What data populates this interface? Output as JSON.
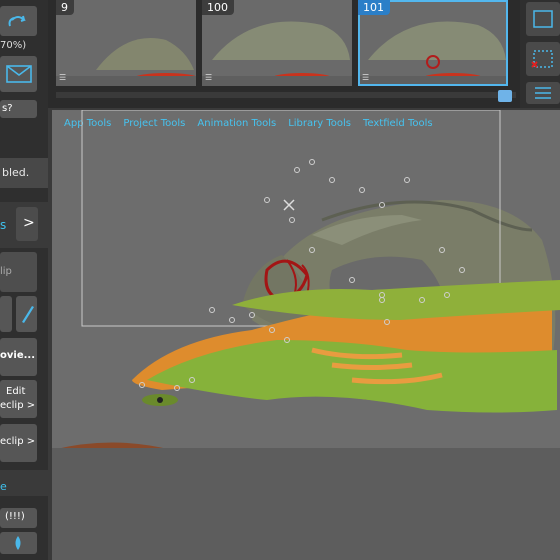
{
  "timeline": {
    "frames": [
      {
        "number": "9"
      },
      {
        "number": "100"
      },
      {
        "number": "101"
      }
    ]
  },
  "left_panel": {
    "zoom_text": "70%)",
    "question_text": "s?",
    "status_text": "bled.",
    "tab_label": "s",
    "arrow_label": ">",
    "clip_field": "lip",
    "movie_button": "ovie...",
    "edit_button_line1": "Edit",
    "edit_button_line2": "eclip >",
    "clip_button": "eclip >",
    "warning_text": "(!!!)",
    "section_label": "e"
  },
  "menu": {
    "items": [
      "App Tools",
      "Project Tools",
      "Animation Tools",
      "Library Tools",
      "Textfield Tools"
    ]
  },
  "colors": {
    "accent": "#3fc2ee",
    "selected_frame_border": "#53b7ee",
    "stage_background": "#6d6d6d",
    "panel_background": "#2f2f2f"
  }
}
